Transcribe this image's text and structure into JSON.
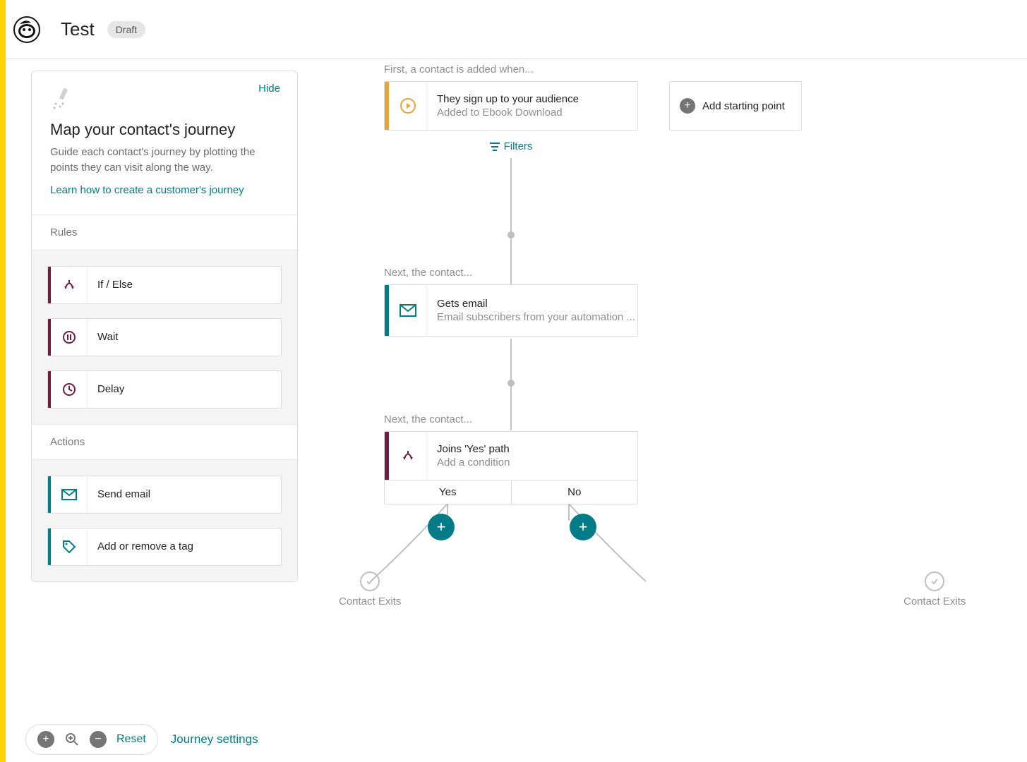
{
  "header": {
    "title": "Test",
    "badge": "Draft"
  },
  "sidebar": {
    "hide": "Hide",
    "intro_title": "Map your contact's journey",
    "intro_desc": "Guide each contact's journey by plotting the points they can visit along the way.",
    "learn": "Learn how to create a customer's journey",
    "rules_header": "Rules",
    "rules": [
      {
        "label": "If / Else"
      },
      {
        "label": "Wait"
      },
      {
        "label": "Delay"
      }
    ],
    "actions_header": "Actions",
    "actions": [
      {
        "label": "Send email"
      },
      {
        "label": "Add or remove a tag"
      }
    ]
  },
  "canvas": {
    "step1_label": "First, a contact is added when...",
    "trigger": {
      "title": "They sign up to your audience",
      "sub": "Added to Ebook Download"
    },
    "add_starting": "Add starting point",
    "filters": "Filters",
    "step2_label": "Next, the contact...",
    "email": {
      "title": "Gets email",
      "sub": "Email subscribers from your automation ..."
    },
    "step3_label": "Next, the contact...",
    "ifelse": {
      "title": "Joins 'Yes' path",
      "sub": "Add a condition",
      "yes": "Yes",
      "no": "No"
    },
    "exit": "Contact Exits"
  },
  "controls": {
    "reset": "Reset",
    "settings": "Journey settings"
  }
}
